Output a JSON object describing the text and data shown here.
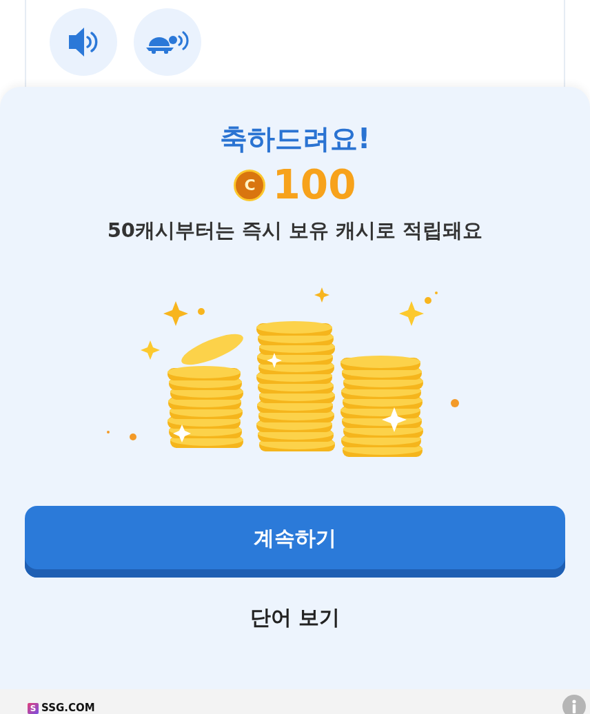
{
  "audio_buttons": [
    {
      "kind": "normal"
    },
    {
      "kind": "slow"
    }
  ],
  "reward": {
    "title": "축하드려요!",
    "coin_symbol": "C",
    "amount": "100",
    "message": "50캐시부터는 즉시 보유 캐시로 적립돼요"
  },
  "buttons": {
    "primary": "계속하기",
    "secondary": "단어 보기"
  },
  "ad": {
    "logo_letter": "S",
    "brand": "SSG.COM"
  }
}
